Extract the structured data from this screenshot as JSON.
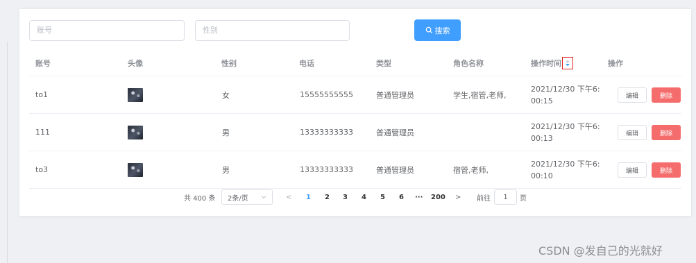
{
  "search": {
    "account_placeholder": "账号",
    "gender_placeholder": "性别",
    "button_label": "搜索"
  },
  "table": {
    "columns": [
      "账号",
      "头像",
      "性别",
      "电话",
      "类型",
      "角色名称",
      "操作时间",
      "操作"
    ],
    "rows": [
      {
        "account": "to1",
        "gender": "女",
        "phone": "15555555555",
        "type": "普通管理员",
        "roles": "学生,宿管,老师,",
        "time_line1": "2021/12/30 下午6:",
        "time_line2": "00:15"
      },
      {
        "account": "111",
        "gender": "男",
        "phone": "13333333333",
        "type": "普通管理员",
        "roles": "",
        "time_line1": "2021/12/30 下午6:",
        "time_line2": "00:13"
      },
      {
        "account": "to3",
        "gender": "男",
        "phone": "13333333333",
        "type": "普通管理员",
        "roles": "宿管,老师,",
        "time_line1": "2021/12/30 下午6:",
        "time_line2": "00:10"
      }
    ],
    "edit_label": "编辑",
    "delete_label": "删除"
  },
  "pagination": {
    "total_text": "共 400 条",
    "page_size": "2条/页",
    "prev_symbol": "<",
    "pages": [
      "1",
      "2",
      "3",
      "4",
      "5",
      "6"
    ],
    "ellipsis": "···",
    "last_page": "200",
    "next_symbol": ">",
    "current_page": 1,
    "goto_label": "前往",
    "goto_value": "1",
    "goto_suffix": "页"
  },
  "icons": {
    "search": "search-icon",
    "sort": "sort-caret-icon",
    "select": "chevron-down-icon"
  },
  "colors": {
    "primary": "#409eff",
    "danger": "#f56c6c",
    "highlight_box": "#e02020"
  },
  "watermark": "CSDN @发自己的光就好"
}
